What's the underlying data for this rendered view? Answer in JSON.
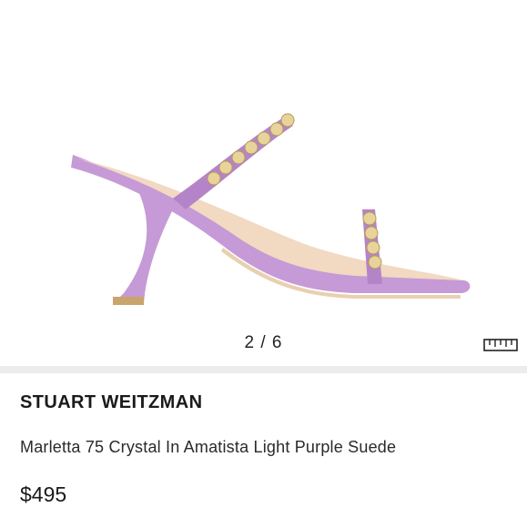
{
  "gallery": {
    "pager_text": "2 / 6",
    "image_icon": "lilac-crystal-heeled-mule-image",
    "size_guide_icon": "ruler-icon"
  },
  "product": {
    "brand": "STUART WEITZMAN",
    "title": "Marletta 75 Crystal In Amatista Light Purple Suede",
    "price": "$495"
  },
  "colors": {
    "suede": "#c69ad6",
    "suede_shadow": "#a978bd",
    "crystal": "#e8d49a",
    "divider": "#ececec"
  }
}
